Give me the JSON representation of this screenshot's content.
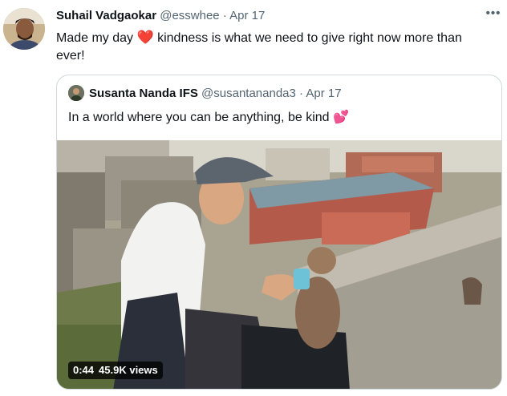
{
  "tweet": {
    "author_name": "Suhail Vadgaokar",
    "author_handle": "@esswhee",
    "separator": "·",
    "date": "Apr 17",
    "more_label": "•••",
    "text_before": "Made my day ",
    "heart_emoji": "❤️",
    "text_after": " kindness is what we need to give right now more than ever!",
    "heart_color": "#e0245e"
  },
  "quoted": {
    "author_name": "Susanta Nanda IFS",
    "author_handle": "@susantananda3",
    "separator": "·",
    "date": "Apr 17",
    "text": "In a world where you can be anything, be kind ",
    "emoji": "💕",
    "video": {
      "duration": "0:44",
      "views": "45.9K views"
    }
  },
  "colors": {
    "secondary_text": "#536471",
    "border": "#cfd9de"
  }
}
